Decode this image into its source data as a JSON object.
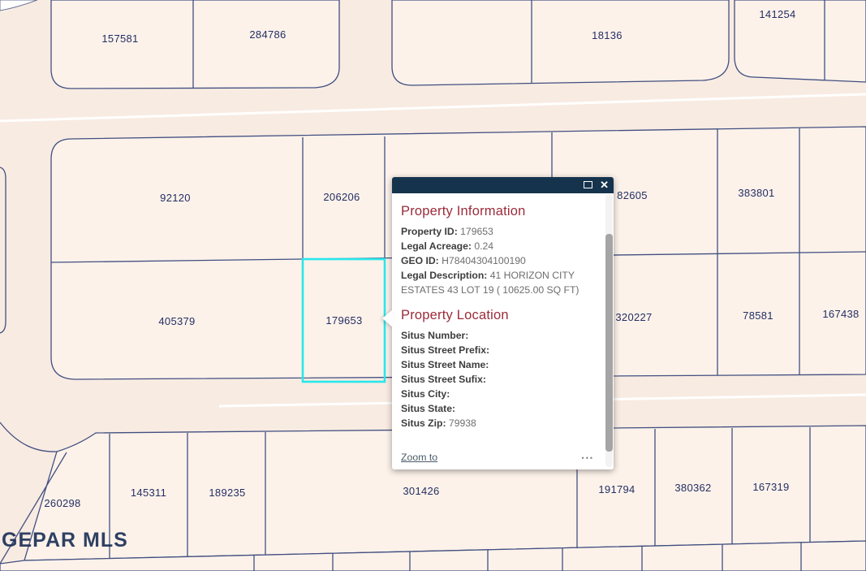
{
  "colors": {
    "popup_header": "#16334d",
    "section_title_red": "#9c2b3a",
    "highlight_cyan": "#29e7ea",
    "parcel_outline": "#424f80",
    "map_background": "#f8ebe2",
    "parcel_fill": "#fcf2ea"
  },
  "map": {
    "watermark": "GEPAR MLS",
    "highlighted_parcel": "179653",
    "parcels": [
      {
        "label": "157581"
      },
      {
        "label": "284786"
      },
      {
        "label": "18136"
      },
      {
        "label": "141254"
      },
      {
        "label": "92120"
      },
      {
        "label": "206206"
      },
      {
        "label": "82605"
      },
      {
        "label": "383801"
      },
      {
        "label": "405379"
      },
      {
        "label": "179653"
      },
      {
        "label": "320227"
      },
      {
        "label": "78581"
      },
      {
        "label": "167438"
      },
      {
        "label": "260298"
      },
      {
        "label": "145311"
      },
      {
        "label": "189235"
      },
      {
        "label": "301426"
      },
      {
        "label": "191794"
      },
      {
        "label": "380362"
      },
      {
        "label": "167319"
      }
    ]
  },
  "popup": {
    "header": {
      "maximize_icon": "maximize",
      "close_glyph": "✕"
    },
    "sections": [
      {
        "title": "Property Information",
        "fields": [
          {
            "label": "Property ID:",
            "value": "179653"
          },
          {
            "label": "Legal Acreage:",
            "value": "0.24"
          },
          {
            "label": "GEO ID:",
            "value": "H78404304100190"
          },
          {
            "label": "Legal Description:",
            "value": "41 HORIZON CITY ESTATES 43 LOT 19 ( 10625.00 SQ FT)"
          }
        ]
      },
      {
        "title": "Property Location",
        "fields": [
          {
            "label": "Situs Number:",
            "value": ""
          },
          {
            "label": "Situs Street Prefix:",
            "value": ""
          },
          {
            "label": "Situs Street Name:",
            "value": ""
          },
          {
            "label": "Situs Street Sufix:",
            "value": ""
          },
          {
            "label": "Situs City:",
            "value": ""
          },
          {
            "label": "Situs State:",
            "value": ""
          },
          {
            "label": "Situs Zip:",
            "value": "79938"
          }
        ]
      }
    ],
    "footer": {
      "zoom_to": "Zoom to",
      "ellipsis": "•••"
    }
  }
}
